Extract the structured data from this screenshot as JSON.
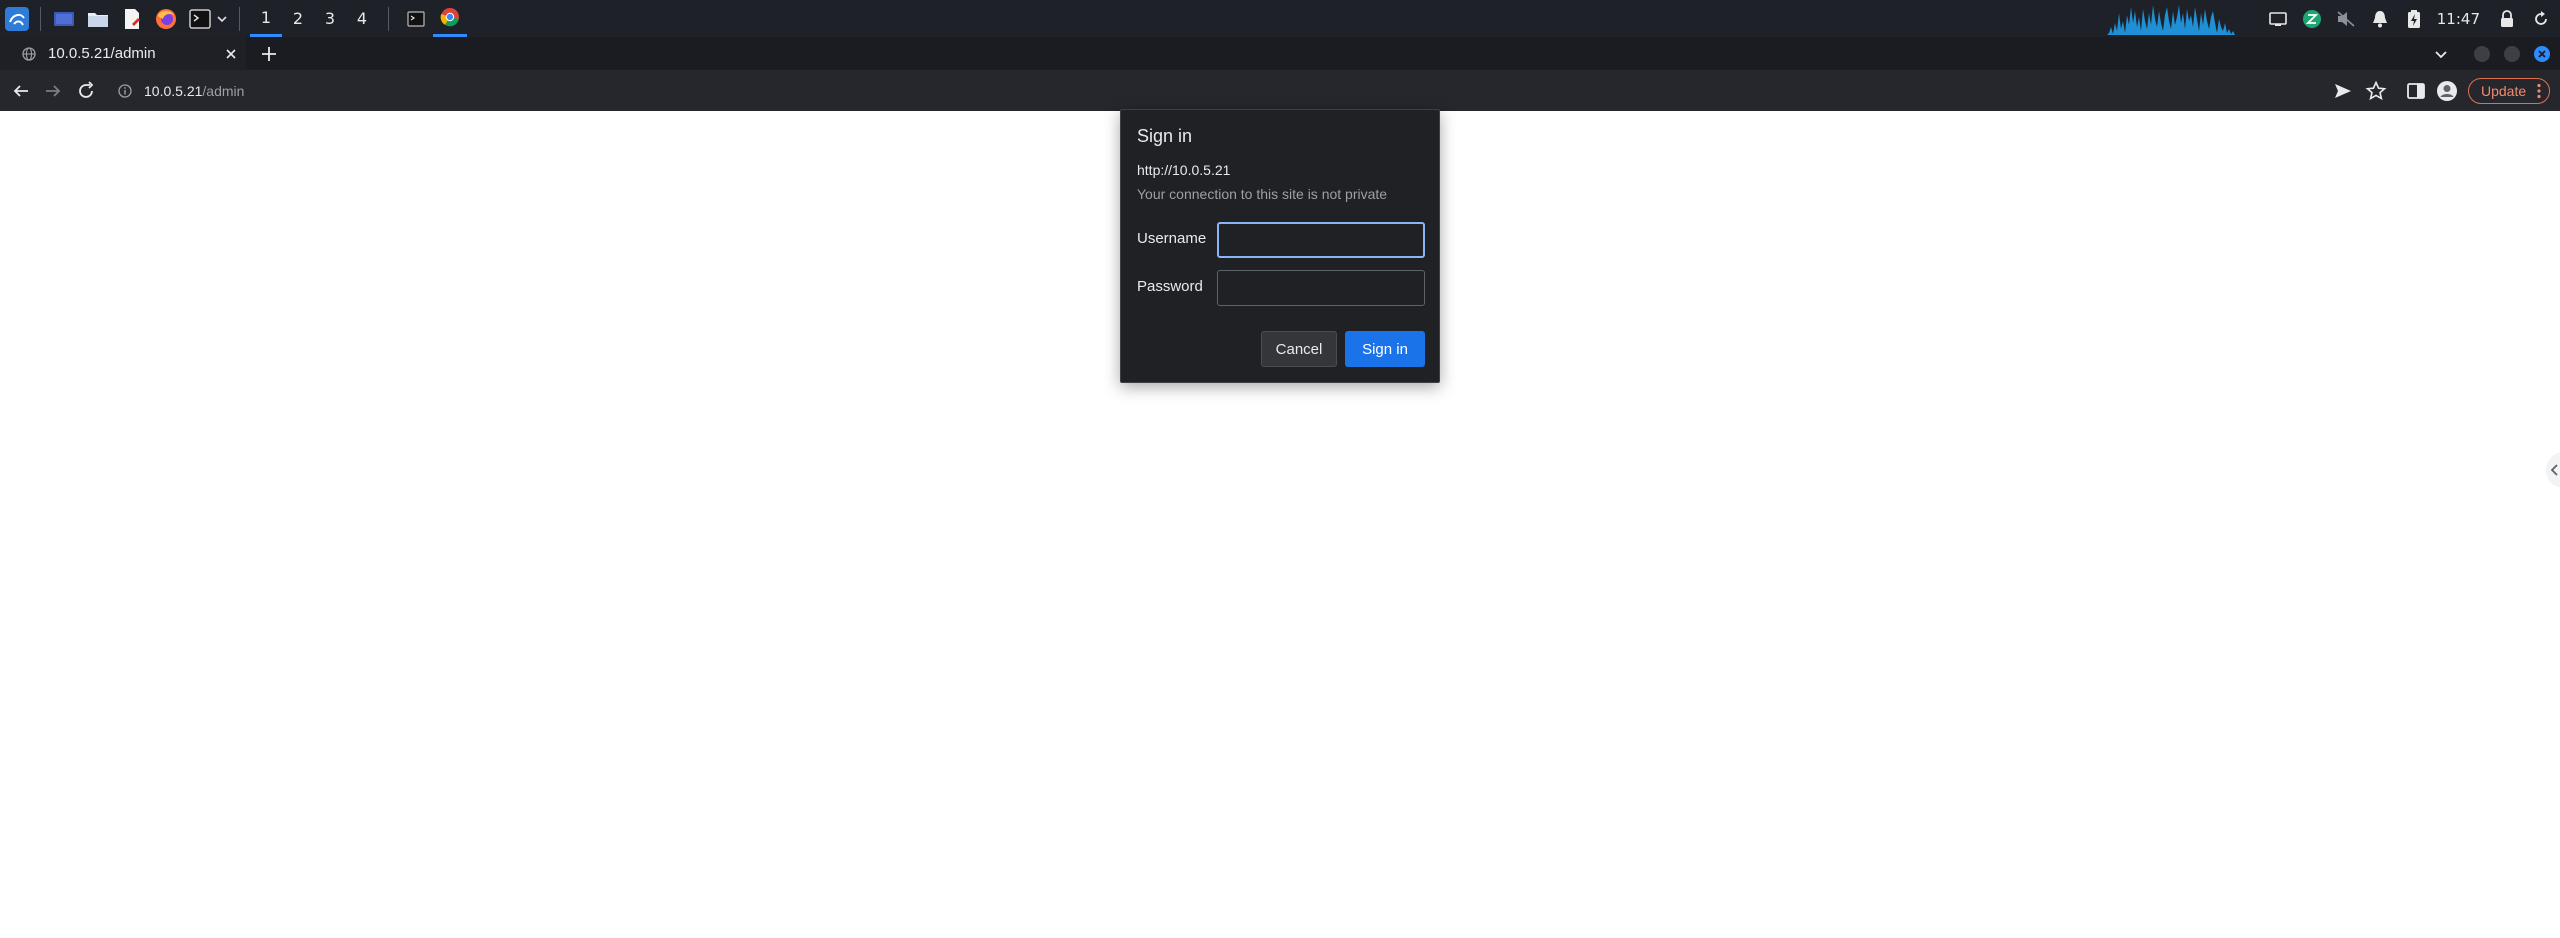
{
  "taskbar": {
    "launchers": [
      "kali-menu-icon",
      "desktop-icon",
      "file-manager-icon",
      "text-editor-icon",
      "firefox-icon",
      "terminal-icon"
    ],
    "workspaces": [
      "1",
      "2",
      "3",
      "4"
    ],
    "active_workspace": "1",
    "windows": [
      "terminal-window-icon",
      "chrome-window-icon"
    ],
    "clock": "11:47"
  },
  "browser": {
    "tab": {
      "title": "10.0.5.21/admin"
    },
    "omnibox": {
      "host": "10.0.5.21",
      "path": "/admin"
    },
    "update_label": "Update"
  },
  "dialog": {
    "title": "Sign in",
    "origin": "http://10.0.5.21",
    "warning": "Your connection to this site is not private",
    "username_label": "Username",
    "username_value": "",
    "password_label": "Password",
    "password_value": "",
    "cancel_label": "Cancel",
    "signin_label": "Sign in"
  },
  "colors": {
    "accent": "#1a73e8",
    "focus_ring": "#8ab4f8",
    "taskbar": "#1e2128",
    "dialog_bg": "#202124",
    "update_text": "#f28b6c"
  }
}
